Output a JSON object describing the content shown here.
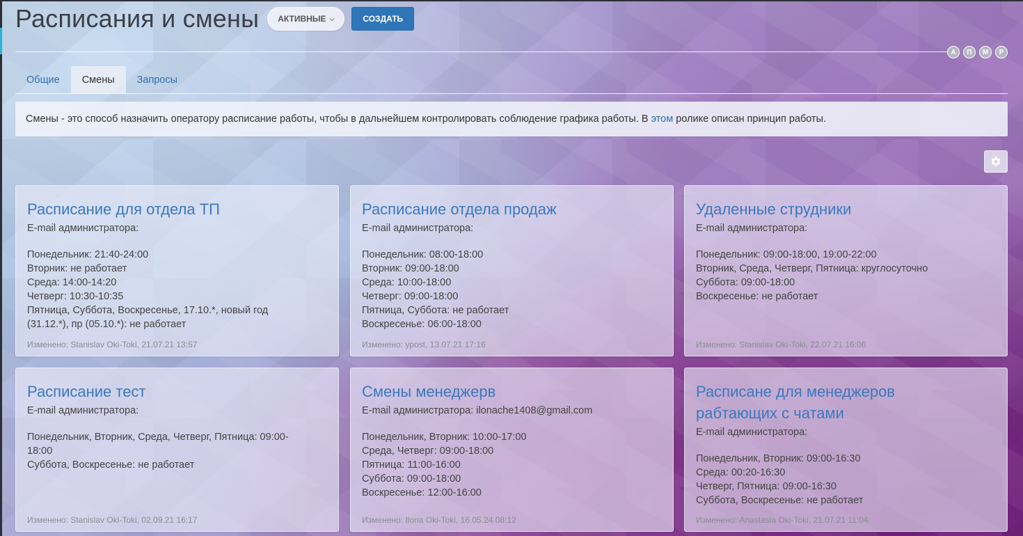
{
  "header": {
    "title": "Расписания и смены",
    "filter_label": "АКТИВНЫЕ",
    "create_label": "СОЗДАТЬ"
  },
  "avatars": [
    "А",
    "П",
    "М",
    "Р"
  ],
  "tabs": [
    {
      "label": "Общие",
      "active": false
    },
    {
      "label": "Смены",
      "active": true
    },
    {
      "label": "Запросы",
      "active": false
    }
  ],
  "info": {
    "text_before": "Смены - это способ назначить оператору расписание работы, чтобы в дальнейшем контролировать соблюдение графика работы. В ",
    "link_text": "этом",
    "text_after": " ролике описан принцип работы."
  },
  "cards": [
    {
      "title": "Расписание для отдела ТП",
      "email": "E-mail администратора:",
      "lines": [
        "Понедельник: 21:40-24:00",
        "Вторник: не работает",
        "Среда: 14:00-14:20",
        "Четверг: 10:30-10:35",
        "Пятница, Суббота, Воскресенье, 17.10.*, новый год",
        "(31.12.*), пр (05.10.*): не работает"
      ],
      "modified": "Изменено: Stanislav Oki-Toki, 21.07.21 13:57"
    },
    {
      "title": "Расписание отдела продаж",
      "email": "E-mail администратора:",
      "lines": [
        "Понедельник: 08:00-18:00",
        "Вторник: 09:00-18:00",
        "Среда: 10:00-18:00",
        "Четверг: 09:00-18:00",
        "Пятница, Суббота: не работает",
        "Воскресенье: 06:00-18:00"
      ],
      "modified": "Изменено: ypost, 13.07.21 17:16"
    },
    {
      "title": "Удаленные струдники",
      "email": "E-mail администратора:",
      "lines": [
        "Понедельник: 09:00-18:00, 19:00-22:00",
        "Вторник, Среда, Четверг, Пятница: круглосуточно",
        "Суббота: 09:00-18:00",
        "Воскресенье: не работает"
      ],
      "modified": "Изменено: Stanislav Oki-Toki, 22.07.21 16:06"
    },
    {
      "title": "Расписание тест",
      "email": "E-mail администратора:",
      "lines": [
        "Понедельник, Вторник, Среда, Четверг, Пятница: 09:00-",
        "18:00",
        "Суббота, Воскресенье: не работает"
      ],
      "modified": "Изменено: Stanislav Oki-Toki, 02.09.21 16:17"
    },
    {
      "title": "Смены менеджерв",
      "email": "E-mail администратора: ilonache1408@gmail.com",
      "lines": [
        "Понедельник, Вторник: 10:00-17:00",
        "Среда, Четверг: 09:00-18:00",
        "Пятница: 11:00-16:00",
        "Суббота: 09:00-18:00",
        "Воскресенье: 12:00-16:00"
      ],
      "modified": "Изменено: Ilona Oki-Toki, 16.05.24 08:12"
    },
    {
      "title": "Расписане для менеджеров рабтающих с чатами",
      "email": "E-mail администратора:",
      "lines": [
        "Понедельник, Вторник: 09:00-16:30",
        "Среда: 00:20-16:30",
        "Четверг, Пятница: 09:00-16:30",
        "Суббота, Воскресенье: не работает"
      ],
      "modified": "Изменено: Anastasia Oki-Toki, 21.07.21 11:04"
    }
  ]
}
